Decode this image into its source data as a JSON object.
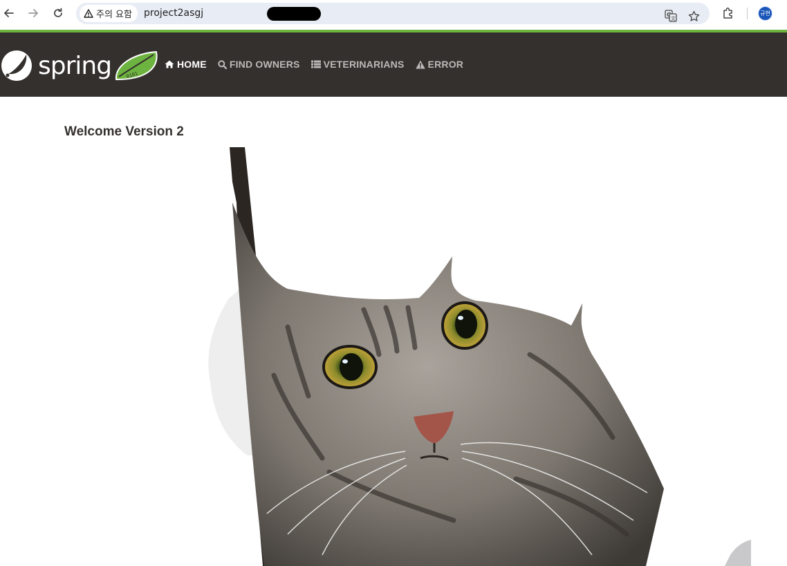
{
  "browser": {
    "security_warning": "주의 요함",
    "url": "project2asgj",
    "profile_initials": "규현",
    "icons": [
      "back-arrow-icon",
      "forward-arrow-icon",
      "reload-icon",
      "warning-triangle-icon",
      "translate-icon",
      "bookmark-star-icon",
      "extensions-puzzle-icon"
    ]
  },
  "navbar": {
    "brand": "spring",
    "items": [
      {
        "label": "HOME",
        "icon": "home-icon",
        "active": true
      },
      {
        "label": "FIND OWNERS",
        "icon": "search-icon",
        "active": false
      },
      {
        "label": "VETERINARIANS",
        "icon": "list-icon",
        "active": false
      },
      {
        "label": "ERROR",
        "icon": "warning-icon",
        "active": false
      }
    ],
    "accent_color": "#6db33f",
    "background_color": "#34302d"
  },
  "main": {
    "heading": "Welcome Version 2",
    "image": "tabby-cat-peeking-through-torn-paper"
  }
}
